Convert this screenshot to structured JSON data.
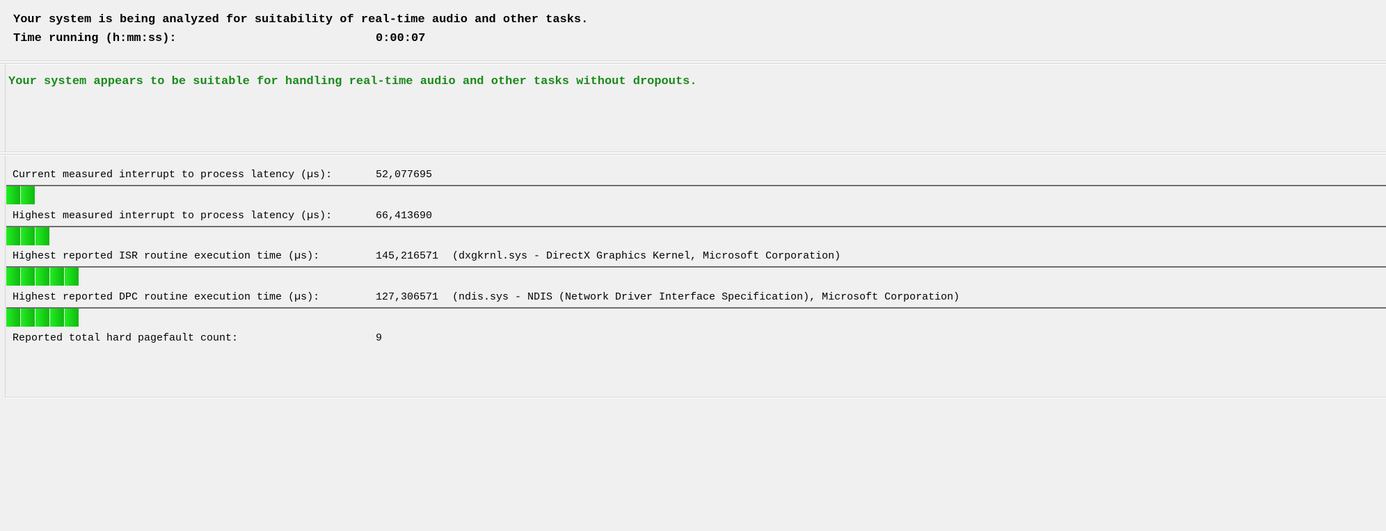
{
  "header": {
    "analyzing_text": "Your system is being analyzed for suitability of real-time audio and other tasks.",
    "time_label": "Time running (h:mm:ss):",
    "time_value": "0:00:07"
  },
  "verdict": {
    "text": "Your system appears to be suitable for handling real-time audio and other tasks without dropouts.",
    "color": "#1a8a1a"
  },
  "measurements": [
    {
      "label": "Current measured interrupt to process latency (µs):",
      "value": "52,077695",
      "extra": "",
      "meter_segments": 2
    },
    {
      "label": "Highest measured interrupt to process latency (µs):",
      "value": "66,413690",
      "extra": "",
      "meter_segments": 3
    },
    {
      "label": "Highest reported ISR routine execution time (µs):",
      "value": "145,216571",
      "extra": "(dxgkrnl.sys - DirectX Graphics Kernel, Microsoft Corporation)",
      "meter_segments": 5
    },
    {
      "label": "Highest reported DPC routine execution time (µs):",
      "value": "127,306571",
      "extra": "(ndis.sys - NDIS (Network Driver Interface Specification), Microsoft Corporation)",
      "meter_segments": 5
    },
    {
      "label": "Reported total hard pagefault count:",
      "value": "9",
      "extra": ""
    }
  ],
  "colors": {
    "background": "#f0f0f0",
    "meter_green_light": "#22ee22",
    "meter_green_dark": "#0fb80f",
    "verdict_green": "#1a8a1a"
  }
}
